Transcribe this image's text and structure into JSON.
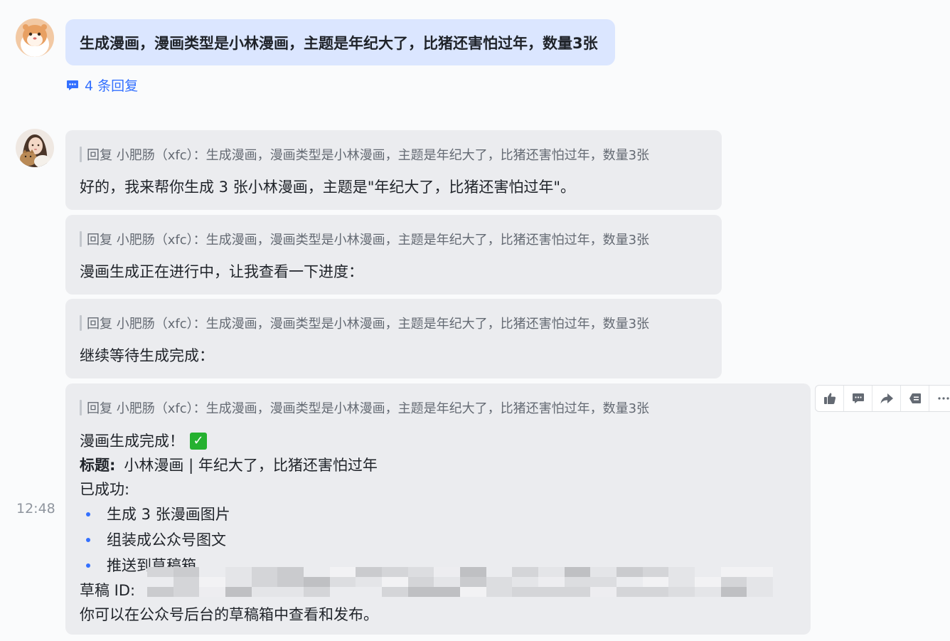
{
  "user_message": {
    "text": "生成漫画，漫画类型是小林漫画，主题是年纪大了，比猪还害怕过年，数量3张",
    "reply_count_label": "4 条回复",
    "reply_icon": "comment-bubble-icon",
    "avatar": "hamster-avatar"
  },
  "bot": {
    "avatar": "girl-with-cat-avatar",
    "time": "12:48",
    "messages": [
      {
        "quote": "回复 小肥肠（xfc）：生成漫画，漫画类型是小林漫画，主题是年纪大了，比猪还害怕过年，数量3张",
        "text": "好的，我来帮你生成 3 张小林漫画，主题是\"年纪大了，比猪还害怕过年\"。"
      },
      {
        "quote": "回复 小肥肠（xfc）：生成漫画，漫画类型是小林漫画，主题是年纪大了，比猪还害怕过年，数量3张",
        "text": "漫画生成正在进行中，让我查看一下进度："
      },
      {
        "quote": "回复 小肥肠（xfc）：生成漫画，漫画类型是小林漫画，主题是年纪大了，比猪还害怕过年，数量3张",
        "text": "继续等待生成完成："
      }
    ],
    "final": {
      "quote": "回复 小肥肠（xfc）：生成漫画，漫画类型是小林漫画，主题是年纪大了，比猪还害怕过年，数量3张",
      "done_text": "漫画生成完成！",
      "done_icon": "check-mark-icon",
      "title_label": "标题:",
      "title_value": "小林漫画 | 年纪大了，比猪还害怕过年",
      "success_label": "已成功:",
      "items": [
        "生成 3 张漫画图片",
        "组装成公众号图文",
        "推送到草稿箱"
      ],
      "draft_label": "草稿 ID:",
      "footer": "你可以在公众号后台的草稿箱中查看和发布。"
    }
  },
  "toolbar": {
    "icons": [
      "thumbs-up-icon",
      "comment-icon",
      "forward-icon",
      "quote-reply-icon",
      "more-icon"
    ]
  },
  "colors": {
    "user_bubble": "#dbe6ff",
    "bot_bubble": "#ebecef",
    "accent": "#3370ff",
    "check": "#25b130"
  }
}
